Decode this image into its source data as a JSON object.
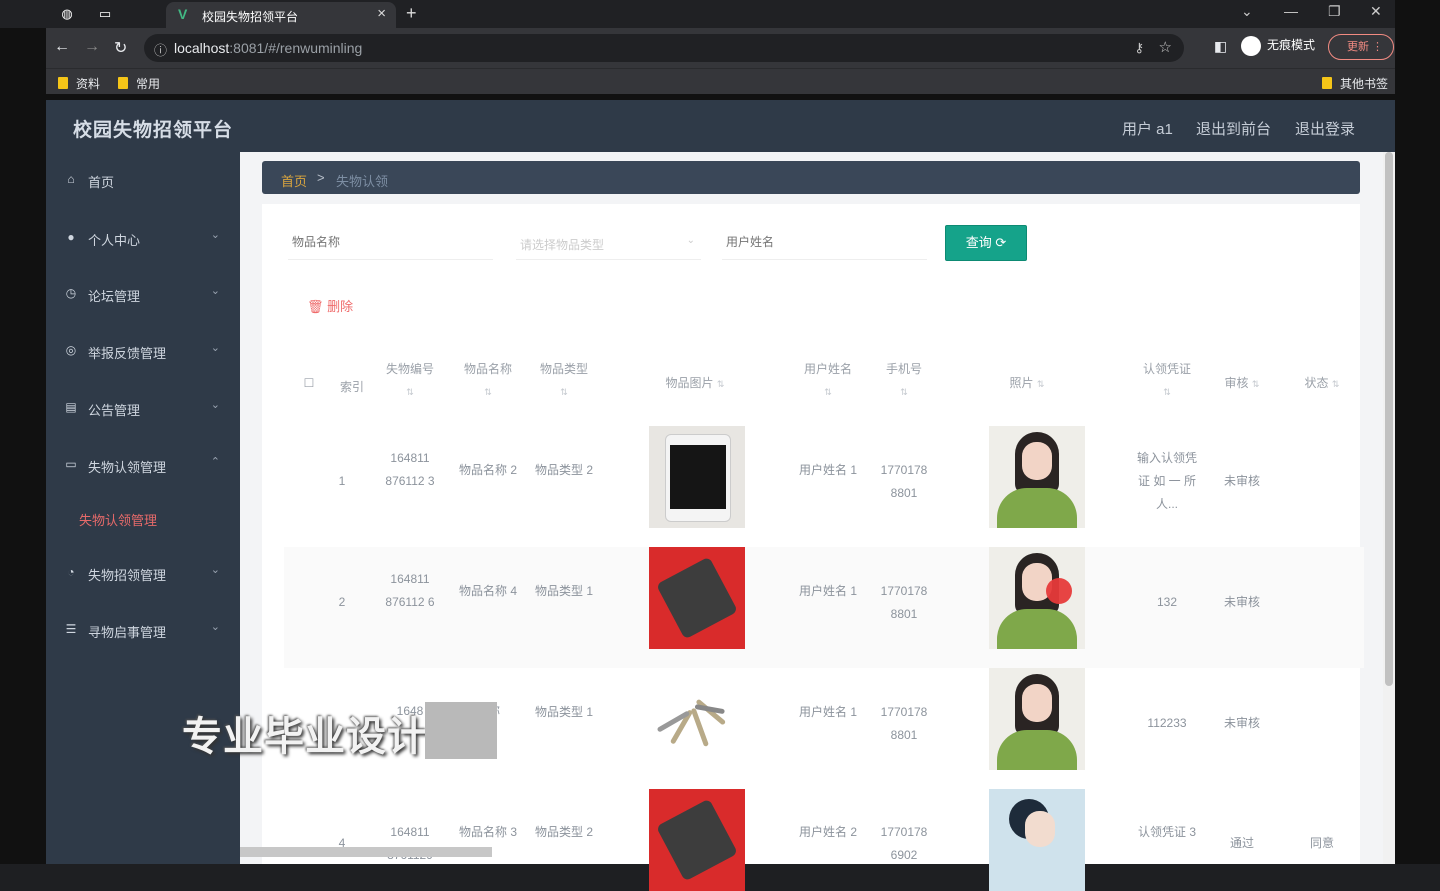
{
  "browser": {
    "tab_title": "校园失物招领平台",
    "tab_favicon": "V",
    "url_host": "localhost",
    "url_rest": ":8081/#/renwuminling",
    "incognito_label": "无痕模式",
    "update_label": "更新",
    "bookmarks": [
      "资料",
      "常用"
    ],
    "other_bookmarks": "其他书签"
  },
  "app": {
    "title": "校园失物招领平台",
    "header_links": [
      "用户 a1",
      "退出到前台",
      "退出登录"
    ]
  },
  "sidebar": {
    "items": [
      {
        "label": "首页",
        "icon": "home-icon"
      },
      {
        "label": "个人中心",
        "icon": "user-icon"
      },
      {
        "label": "论坛管理",
        "icon": "forum-icon"
      },
      {
        "label": "举报反馈管理",
        "icon": "report-icon"
      },
      {
        "label": "公告管理",
        "icon": "notice-icon"
      },
      {
        "label": "失物认领管理",
        "icon": "claim-icon"
      },
      {
        "label": "失物招领管理",
        "icon": "lost-icon"
      },
      {
        "label": "寻物启事管理",
        "icon": "list-icon"
      }
    ],
    "active_sub": "失物认领管理"
  },
  "breadcrumb": {
    "home": "首页",
    "sep": ">",
    "current": "失物认领"
  },
  "search": {
    "placeholder_name": "物品名称",
    "placeholder_type": "请选择物品类型",
    "placeholder_user": "用户姓名",
    "query_label": "查询",
    "delete_label": "删除"
  },
  "table": {
    "headers": [
      "索引",
      "失物编号",
      "物品名称",
      "物品类型",
      "物品图片",
      "用户姓名",
      "手机号",
      "照片",
      "认领凭证",
      "审核",
      "状态"
    ],
    "rows": [
      {
        "index": "1",
        "code": "164811 876112 3",
        "name": "物品名称 2",
        "type": "物品类型 2",
        "image": "phone",
        "user": "用户姓名 1",
        "phone": "1770178 8801",
        "photo": "avatar",
        "proof": "输入认领凭证 如 一 所人...",
        "review": "未审核",
        "status": ""
      },
      {
        "index": "2",
        "code": "164811 876112 6",
        "name": "物品名称 4",
        "type": "物品类型 1",
        "image": "wallet",
        "user": "用户姓名 1",
        "phone": "1770178 8801",
        "photo": "avatar",
        "proof": "132",
        "review": "未审核",
        "status": ""
      },
      {
        "index": "3",
        "code": "1648",
        "name": "名称",
        "type": "物品类型 1",
        "image": "keys",
        "user": "用户姓名 1",
        "phone": "1770178 8801",
        "photo": "avatar",
        "proof": "112233",
        "review": "未审核",
        "status": ""
      },
      {
        "index": "4",
        "code": "164811 8761129",
        "name": "物品名称 3",
        "type": "物品类型 2",
        "image": "wallet",
        "user": "用户姓名 2",
        "phone": "1770178 6902",
        "photo": "avatar2",
        "proof": "认领凭证 3",
        "review": "通过",
        "status": "同意"
      }
    ]
  },
  "overlay": {
    "watermark": "专业毕业设计"
  }
}
